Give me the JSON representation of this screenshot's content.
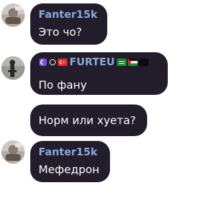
{
  "messages": [
    {
      "author": "Fanter15k",
      "text": "Это чо?"
    },
    {
      "author": "FURTEU",
      "text": "По фану"
    },
    {
      "author": "",
      "text": "Норм или хуета?"
    },
    {
      "author": "Fanter15k",
      "text": "Мефедрон"
    }
  ],
  "colors": {
    "bubble": "#221c2b",
    "name": "#8aa8dc",
    "text": "#ffffff"
  },
  "icons": {
    "before_name": [
      "moon-badge-icon",
      "ring-badge-icon",
      "turkey-flag-icon"
    ],
    "after_name": [
      "saudi-flag-icon",
      "palestine-flag-icon",
      "black-flag-icon"
    ]
  }
}
